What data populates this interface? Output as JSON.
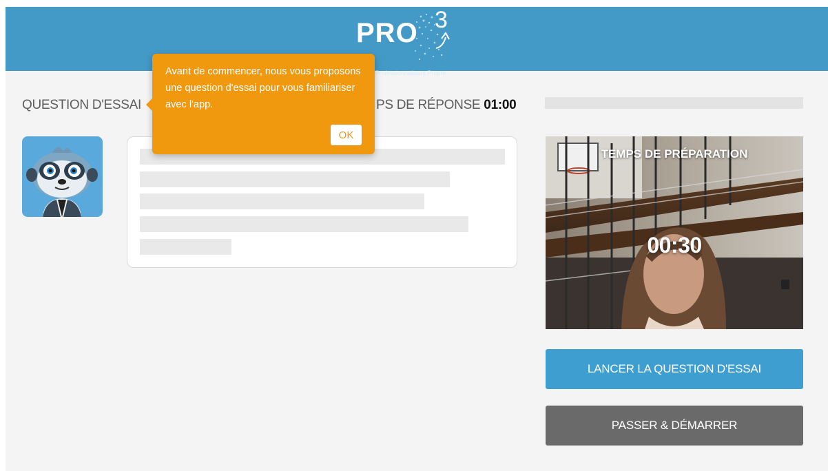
{
  "header": {
    "logo_text": "PRO",
    "logo_superscript": "3",
    "logo_tagline": "e Professionnalisant Propre"
  },
  "question": {
    "label": "QUESTION D'ESSAI",
    "time_label": "PS DE RÉPONSE",
    "time_value": "01:00"
  },
  "tooltip": {
    "text": "Avant de commencer, nous vous proposons une question d'essai pour vous familiariser avec l'app.",
    "ok_label": "OK"
  },
  "video": {
    "title": "TEMPS DE PRÉPARATION",
    "timer": "00:30"
  },
  "buttons": {
    "launch_label": "LANCER LA QUESTION D'ESSAI",
    "skip_label": "PASSER & DÉMARRER"
  },
  "colors": {
    "header_blue": "#439ac6",
    "tooltip_orange": "#f0980e",
    "primary_button": "#3f9ed0",
    "secondary_button": "#6a6a6a"
  },
  "icons": {
    "avatar": "meerkat-mascot-icon"
  }
}
